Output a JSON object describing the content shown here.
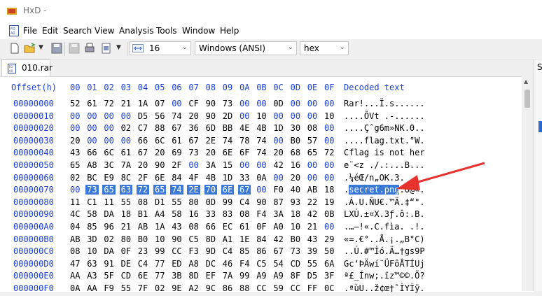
{
  "window": {
    "title": "HxD - "
  },
  "menu": [
    "File",
    "Edit",
    "Search",
    "View",
    "Analysis",
    "Tools",
    "Window",
    "Help"
  ],
  "toolbar": {
    "bytes_per_row": "16",
    "charset": "Windows (ANSI)",
    "offset_base": "hex"
  },
  "tab": {
    "label": "010.rar"
  },
  "right_panel": {
    "label": "S"
  },
  "hex": {
    "offset_header": "Offset(h)",
    "columns": [
      "00",
      "01",
      "02",
      "03",
      "04",
      "05",
      "06",
      "07",
      "08",
      "09",
      "0A",
      "0B",
      "0C",
      "0D",
      "0E",
      "0F"
    ],
    "decoded_header": "Decoded text",
    "rows": [
      {
        "offset": "00000000",
        "bytes": [
          "52",
          "61",
          "72",
          "21",
          "1A",
          "07",
          "00",
          "CF",
          "90",
          "73",
          "00",
          "00",
          "0D",
          "00",
          "00",
          "00"
        ],
        "text": "Rar!...Ï.s......"
      },
      {
        "offset": "00000010",
        "bytes": [
          "00",
          "00",
          "00",
          "00",
          "D5",
          "56",
          "74",
          "20",
          "90",
          "2D",
          "00",
          "10",
          "00",
          "00",
          "00",
          "10"
        ],
        "text": "....ÕVt .-......"
      },
      {
        "offset": "00000020",
        "bytes": [
          "00",
          "00",
          "00",
          "02",
          "C7",
          "88",
          "67",
          "36",
          "6D",
          "BB",
          "4E",
          "4B",
          "1D",
          "30",
          "08",
          "00"
        ],
        "text": "....Çˆg6m»NK.0.."
      },
      {
        "offset": "00000030",
        "bytes": [
          "20",
          "00",
          "00",
          "00",
          "66",
          "6C",
          "61",
          "67",
          "2E",
          "74",
          "78",
          "74",
          "00",
          "B0",
          "57",
          "00"
        ],
        "text": "....flag.txt.°W."
      },
      {
        "offset": "00000040",
        "bytes": [
          "43",
          "66",
          "6C",
          "61",
          "67",
          "20",
          "69",
          "73",
          "20",
          "6E",
          "6F",
          "74",
          "20",
          "68",
          "65",
          "72"
        ],
        "text": "Cflag is not her"
      },
      {
        "offset": "00000050",
        "bytes": [
          "65",
          "A8",
          "3C",
          "7A",
          "20",
          "90",
          "2F",
          "00",
          "3A",
          "15",
          "00",
          "00",
          "42",
          "16",
          "00",
          "00"
        ],
        "text": "e¨<z ./.:...B..."
      },
      {
        "offset": "00000060",
        "bytes": [
          "02",
          "BC",
          "E9",
          "8C",
          "2F",
          "6E",
          "84",
          "4F",
          "4B",
          "1D",
          "33",
          "0A",
          "00",
          "20",
          "00",
          "00"
        ],
        "text": ".¼éŒ/n„OK.3. .."
      },
      {
        "offset": "00000070",
        "bytes": [
          "00",
          "73",
          "65",
          "63",
          "72",
          "65",
          "74",
          "2E",
          "70",
          "6E",
          "67",
          "00",
          "F0",
          "40",
          "AB",
          "18"
        ],
        "text_pre": ".",
        "text_sel": "secret.png",
        "text_post": ".ð@«.",
        "selected": [
          1,
          2,
          3,
          4,
          5,
          6,
          7,
          8,
          9,
          10
        ]
      },
      {
        "offset": "00000080",
        "bytes": [
          "11",
          "C1",
          "11",
          "55",
          "08",
          "D1",
          "55",
          "80",
          "0D",
          "99",
          "C4",
          "90",
          "87",
          "93",
          "22",
          "19"
        ],
        "text": ".Á.U.ÑU€.™Ä.‡“\"."
      },
      {
        "offset": "00000090",
        "bytes": [
          "4C",
          "58",
          "DA",
          "18",
          "B1",
          "A4",
          "58",
          "16",
          "33",
          "83",
          "08",
          "F4",
          "3A",
          "18",
          "42",
          "0B"
        ],
        "text": "LXÚ.±¤X.3ƒ.ô:.B."
      },
      {
        "offset": "000000A0",
        "bytes": [
          "04",
          "85",
          "96",
          "21",
          "AB",
          "1A",
          "43",
          "08",
          "66",
          "EC",
          "61",
          "0F",
          "A0",
          "10",
          "21",
          "00"
        ],
        "text": ".…–!«.C.fìa. .!."
      },
      {
        "offset": "000000B0",
        "bytes": [
          "AB",
          "3D",
          "02",
          "80",
          "B0",
          "10",
          "90",
          "C5",
          "8D",
          "A1",
          "1E",
          "84",
          "42",
          "B0",
          "43",
          "29"
        ],
        "text": "«=.€°..Å.¡.„B°C)"
      },
      {
        "offset": "000000C0",
        "bytes": [
          "08",
          "10",
          "DA",
          "0F",
          "23",
          "99",
          "CC",
          "F3",
          "9D",
          "C4",
          "85",
          "86",
          "67",
          "73",
          "39",
          "50"
        ],
        "text": "..Ú.#™Ìó.Ä…†gs9P"
      },
      {
        "offset": "000000D0",
        "bytes": [
          "47",
          "63",
          "91",
          "DE",
          "C4",
          "77",
          "ED",
          "A8",
          "DC",
          "46",
          "F4",
          "C5",
          "54",
          "CD",
          "55",
          "6A"
        ],
        "text": "Gc‘ÞÄwí¨ÜFôÅTÍUj"
      },
      {
        "offset": "000000E0",
        "bytes": [
          "AA",
          "A3",
          "5F",
          "CD",
          "6E",
          "77",
          "3B",
          "8D",
          "EF",
          "7A",
          "99",
          "A9",
          "A9",
          "8F",
          "D5",
          "3F"
        ],
        "text": "ª£_Ínw;.ïz™©©.Õ?"
      },
      {
        "offset": "000000F0",
        "bytes": [
          "0A",
          "AA",
          "F9",
          "55",
          "7F",
          "02",
          "9E",
          "A2",
          "9C",
          "86",
          "88",
          "CC",
          "59",
          "CC",
          "FF",
          "0C"
        ],
        "text": ".ªùU..ž¢œ†ˆÌYÌÿ."
      }
    ]
  },
  "colors": {
    "offset_blue": "#1a3fd9",
    "selection": "#3a79d8",
    "annotation_arrow": "#e8322e"
  },
  "icons": [
    "hxd-app-icon",
    "hxd-menu-icon",
    "new-file-icon",
    "open-folder-icon",
    "dropdown-icon",
    "save-icon",
    "save-disabled-icon",
    "print-icon",
    "page-icon",
    "width-arrows-icon",
    "file-tab-icon",
    "scroll-up-icon"
  ]
}
